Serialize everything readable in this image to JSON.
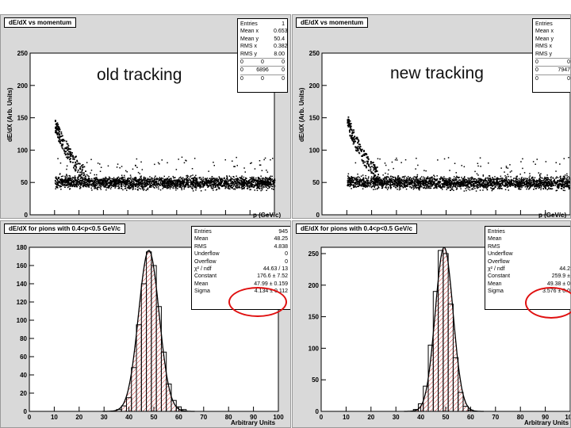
{
  "annotations": {
    "left": "old tracking",
    "right": "new tracking"
  },
  "panels": {
    "tl": {
      "title": "dE/dX vs momentum",
      "ylabel": "dE/dX (Arb. Units)",
      "xlabel": "p (GeV/c)",
      "stats": [
        [
          "Entries",
          "1"
        ],
        [
          "Mean x",
          "0.653"
        ],
        [
          "Mean y",
          "50.4"
        ],
        [
          "RMS x",
          "0.382"
        ],
        [
          "RMS y",
          "8.00"
        ]
      ],
      "grid": [
        [
          "0",
          "0",
          "0"
        ],
        [
          "0",
          "6896",
          "0"
        ],
        [
          "0",
          "0",
          "0"
        ]
      ]
    },
    "tr": {
      "title": "dE/dX vs momentum",
      "ylabel": "dE/dX (Arb. Units)",
      "xlabel": "p (GeV/c)",
      "stats": [
        [
          "Entries",
          ""
        ],
        [
          "Mean x",
          ""
        ],
        [
          "Mean y",
          ""
        ],
        [
          "RMS x",
          ""
        ],
        [
          "RMS y",
          ""
        ]
      ],
      "grid": [
        [
          "0",
          "0"
        ],
        [
          "0",
          "7947"
        ],
        [
          "0",
          "0"
        ]
      ]
    },
    "bl": {
      "title": "dE/dX for pions with 0.4<p<0.5 GeV/c",
      "xlabel": "Arbitrary Units",
      "stats": [
        [
          "Entries",
          "945"
        ],
        [
          "Mean",
          "48.25"
        ],
        [
          "RMS",
          "4.838"
        ],
        [
          "Underflow",
          "0"
        ],
        [
          "Overflow",
          "0"
        ],
        [
          "χ² / ndf",
          "44.63 / 13"
        ],
        [
          "Constant",
          "176.6 ± 7.52"
        ],
        [
          "Mean",
          "47.99 ± 0.159"
        ],
        [
          "Sigma",
          "4.134 ± 0.112"
        ]
      ]
    },
    "br": {
      "title": "dE/dX for pions with 0.4<p<0.5 GeV/c",
      "xlabel": "Arbitrary Units",
      "stats": [
        [
          "Entries",
          ""
        ],
        [
          "Mean",
          ""
        ],
        [
          "RMS",
          ""
        ],
        [
          "Underflow",
          ""
        ],
        [
          "Overflow",
          ""
        ],
        [
          "χ² / ndf",
          "44.2"
        ],
        [
          "Constant",
          "259.9 ±"
        ],
        [
          "Mean",
          "49.38 ± 0"
        ],
        [
          "Sigma",
          "3.576 ± 0.0"
        ]
      ]
    }
  },
  "chart_data": [
    {
      "type": "scatter",
      "title": "dE/dX vs momentum",
      "xlabel": "p (GeV/c)",
      "ylabel": "dE/dX (Arb. Units)",
      "xlim": [
        0,
        2
      ],
      "ylim": [
        0,
        250
      ],
      "xticks": [
        "0",
        "0.2",
        "0.4",
        "0.6",
        "0.8",
        "1",
        "1.2",
        "1.4",
        "1.6",
        "1.8",
        "2"
      ],
      "yticks": [
        "0",
        "50",
        "100",
        "150",
        "200",
        "250"
      ],
      "bands": [
        {
          "name": "",
          "x": [
            0.2,
            0.22,
            0.25,
            0.3,
            0.35,
            0.4,
            0.45
          ],
          "y": [
            140,
            130,
            118,
            100,
            85,
            72,
            62
          ]
        },
        {
          "name": "",
          "x": [
            0.2,
            0.5,
            1.0,
            1.5,
            2.0
          ],
          "y": [
            52,
            51,
            50,
            50,
            50
          ]
        }
      ],
      "color": "#000000"
    },
    {
      "type": "scatter",
      "title": "dE/dX vs momentum",
      "xlabel": "p (GeV/c)",
      "ylabel": "dE/dX (Arb. Units)",
      "xlim": [
        0,
        2
      ],
      "ylim": [
        0,
        250
      ],
      "xticks": [
        "0",
        "0.2",
        "0.4",
        "0.6",
        "0.8",
        "1",
        "1.2",
        "1.4",
        "1.6",
        "1.8",
        "2"
      ],
      "yticks": [
        "0",
        "50",
        "100",
        "150",
        "200",
        "250"
      ],
      "bands": [
        {
          "name": "",
          "x": [
            0.2,
            0.22,
            0.25,
            0.3,
            0.35,
            0.4,
            0.45
          ],
          "y": [
            145,
            135,
            120,
            100,
            85,
            72,
            62
          ]
        },
        {
          "name": "",
          "x": [
            0.2,
            0.5,
            1.0,
            1.5,
            2.0
          ],
          "y": [
            52,
            51,
            50,
            50,
            50
          ]
        }
      ],
      "color": "#000000"
    },
    {
      "type": "bar",
      "title": "dE/dX for pions with 0.4<p<0.5 GeV/c",
      "xlabel": "Arbitrary Units",
      "xlim": [
        0,
        100
      ],
      "ylim": [
        0,
        180
      ],
      "xticks": [
        "0",
        "10",
        "20",
        "30",
        "40",
        "50",
        "60",
        "70",
        "80",
        "90",
        "100"
      ],
      "yticks": [
        "0",
        "20",
        "40",
        "60",
        "80",
        "100",
        "120",
        "140",
        "160",
        "180"
      ],
      "binwidth": 2,
      "x": [
        36,
        38,
        40,
        42,
        44,
        46,
        48,
        50,
        52,
        54,
        56,
        58,
        60,
        62
      ],
      "values": [
        2,
        6,
        15,
        48,
        95,
        140,
        175,
        160,
        115,
        65,
        30,
        12,
        5,
        2
      ],
      "fit": {
        "type": "gaussian",
        "constant": 176.6,
        "mean": 47.99,
        "sigma": 4.134
      },
      "colors": {
        "hatch": "#cc3333",
        "hist": "#000000"
      }
    },
    {
      "type": "bar",
      "title": "dE/dX for pions with 0.4<p<0.5 GeV/c",
      "xlabel": "Arbitrary Units",
      "xlim": [
        0,
        100
      ],
      "ylim": [
        0,
        260
      ],
      "xticks": [
        "0",
        "10",
        "20",
        "30",
        "40",
        "50",
        "60",
        "70",
        "80",
        "90",
        "100"
      ],
      "yticks": [
        "0",
        "50",
        "100",
        "150",
        "200",
        "250"
      ],
      "binwidth": 2,
      "x": [
        38,
        40,
        42,
        44,
        46,
        48,
        50,
        52,
        54,
        56,
        58,
        60
      ],
      "values": [
        3,
        12,
        40,
        105,
        190,
        255,
        250,
        170,
        85,
        30,
        8,
        2
      ],
      "fit": {
        "type": "gaussian",
        "constant": 259.9,
        "mean": 49.38,
        "sigma": 3.576
      },
      "colors": {
        "hatch": "#cc3333",
        "hist": "#000000"
      }
    }
  ]
}
